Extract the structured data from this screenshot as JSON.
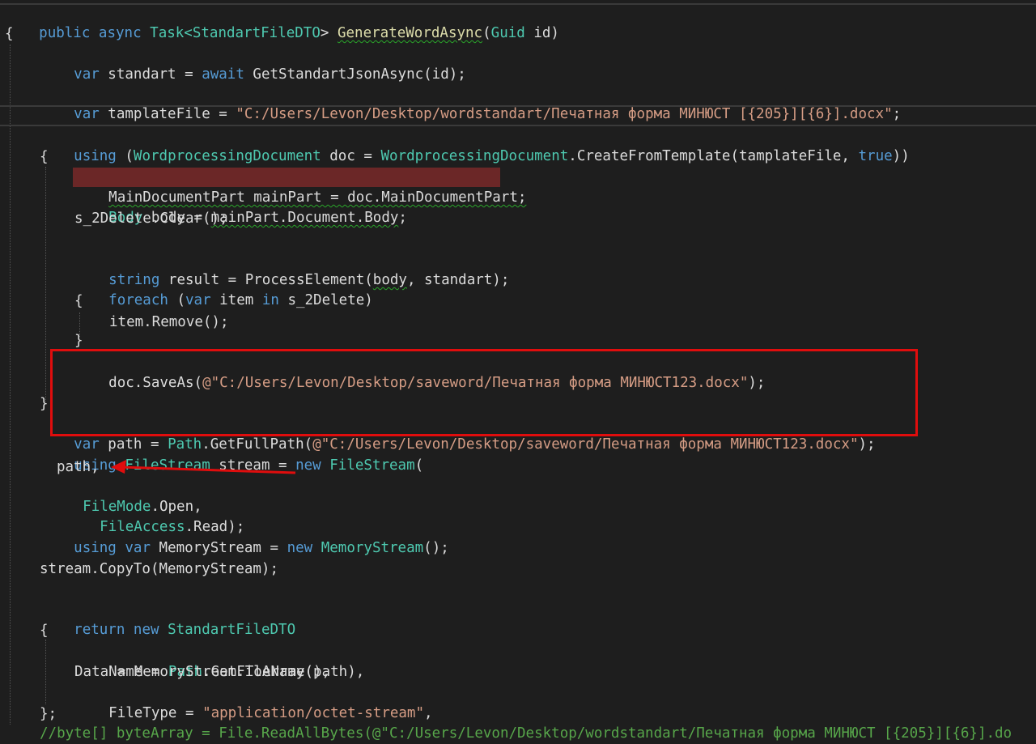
{
  "code": {
    "l1": {
      "kw1": "public",
      "kw2": "async",
      "t1": "Task<",
      "t2": "StandartFileDTO",
      "t3": ">",
      "sp": " ",
      "fn": "GenerateWordAsync",
      "p1": "(",
      "ty": "Guid",
      "p2": " id)"
    },
    "l2": "{",
    "l3": {
      "kw": "var",
      "t": " standart = ",
      "kw2": "await",
      "t2": " GetStandartJsonAsync(id);"
    },
    "l4": {
      "kw": "var",
      "t": " tamplateFile = ",
      "s": "\"C:/Users/Levon/Desktop/wordstandart/Печатная форма МИНЮСТ [{205}][{6}].docx\"",
      "e": ";"
    },
    "l5": {
      "kw": "using",
      "p": " (",
      "ty": "WordprocessingDocument",
      "t": " doc = ",
      "ty2": "WordprocessingDocument",
      "t2": ".CreateFromTemplate(tamplateFile, ",
      "kw2": "true",
      "e": "))"
    },
    "l6": "{",
    "l7": "MainDocumentPart mainPart = doc.MainDocumentPart;",
    "l8": {
      "ty": "Body",
      "t": " body = ",
      "t2": "mainPart.Document.Body",
      ";": ";"
    },
    "l9": "s_2Delete.Clear();",
    "l10": {
      "kw": "string",
      "t": " result = ProcessElement(",
      "w": "body",
      "t2": ", standart);"
    },
    "l11": {
      "kw": "foreach",
      "p": " (",
      "kw2": "var",
      "t": " item ",
      "kw3": "in",
      "t2": " s_2Delete)"
    },
    "l12": "{",
    "l13": "item.Remove();",
    "l14": "}",
    "l15": {
      "t": "doc.SaveAs(",
      "s": "@\"C:/Users/Levon/Desktop/saveword/Печатная форма МИНЮСТ123.docx\"",
      "e": ");"
    },
    "l16": "}",
    "l17": {
      "kw": "var",
      "t": " path = ",
      "ty": "Path",
      "t2": ".GetFullPath(",
      "s": "@\"C:/Users/Levon/Desktop/saveword/Печатная форма МИНЮСТ123.docx\"",
      "e": ");"
    },
    "l18": {
      "kw": "using",
      "sp": " ",
      "ty": "FileStream",
      "t": " stream = ",
      "kw2": "new",
      "sp2": " ",
      "ty2": "FileStream",
      "e": "("
    },
    "l19": "path,",
    "l20": {
      "ty": "FileMode",
      "t": ".Open,"
    },
    "l21": {
      "ty": "FileAccess",
      "t": ".Read);"
    },
    "l22": {
      "kw": "using",
      "sp": " ",
      "kw2": "var",
      "t": " MemoryStream = ",
      "kw3": "new",
      "sp2": " ",
      "ty": "MemoryStream",
      "e": "();"
    },
    "l23": "stream.CopyTo(MemoryStream);",
    "l24": {
      "kw": "return",
      "sp": " ",
      "kw2": "new",
      "sp2": " ",
      "ty": "StandartFileDTO"
    },
    "l25": "{",
    "l26": {
      "t": "Name = ",
      "ty": "Path",
      "t2": ".GetFileName(path),"
    },
    "l27": "Data = MemoryStream.ToArray(),",
    "l28": {
      "t": "FileType = ",
      "s": "\"application/octet-stream\"",
      "e": ","
    },
    "l29": "};",
    "l30": "//byte[] byteArray = File.ReadAllBytes(@\"C:/Users/Levon/Desktop/wordstandart/Печатная форма МИНЮСТ [{205}][{6}].do"
  },
  "colors": {
    "background": "#1e1e1e",
    "keyword": "#569cd6",
    "type": "#4ec9b0",
    "string": "#d69d85",
    "breakpoint_line": "#6b2727",
    "annotation_red": "#e00d0d"
  }
}
